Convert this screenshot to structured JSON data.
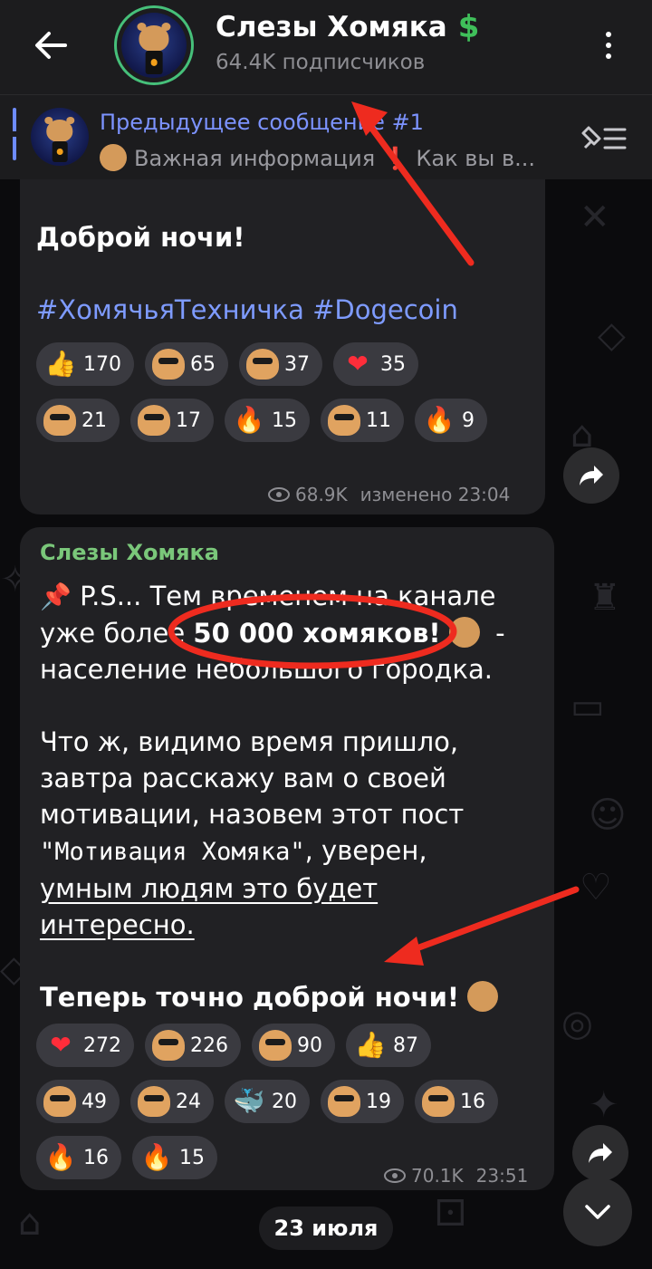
{
  "header": {
    "title": "Слезы Хомяка",
    "subtitle": "64.4K подписчиков",
    "title_badge_icon": "dollar-sign-icon"
  },
  "pinned": {
    "title": "Предыдущее сообщение #1",
    "text_part1": "Важная информация",
    "exclamation": "❗",
    "text_part2": "Как вы в..."
  },
  "message1": {
    "greeting": "Доброй ночи!",
    "hashtag1": "#ХомячьяТехничка",
    "hashtag2": "#Dogecoin",
    "reactions": [
      {
        "icon": "thumbs-up-icon",
        "count": "170"
      },
      {
        "icon": "hamster-laptop-icon",
        "count": "65"
      },
      {
        "icon": "hamster-cool-icon",
        "count": "37"
      },
      {
        "icon": "red-heart-icon",
        "count": "35"
      },
      {
        "icon": "hamster-fire-icon",
        "count": "21"
      },
      {
        "icon": "hamster-money-icon",
        "count": "17"
      },
      {
        "icon": "fire-icon",
        "count": "15"
      },
      {
        "icon": "hamster-face-icon",
        "count": "11"
      },
      {
        "icon": "fire-icon",
        "count": "9"
      }
    ],
    "views": "68.9K",
    "edited_time": "изменено 23:04"
  },
  "message2": {
    "sender": "Слезы Хомяка",
    "line1": "P.S... Тем временем на канале",
    "line2_a": "уже более ",
    "line2_b": "50 000 хомяков!",
    "line2_c": " -",
    "line3": "население небольшого городка.",
    "para2_line1": "Что ж, видимо время пришло,",
    "para2_line2": "завтра расскажу вам о своей",
    "para2_line3": "мотивации, назовем этот пост",
    "para2_line4a": "\"Мотивация Хомяка\"",
    "para2_line4b": ", уверен,",
    "para2_line5": "умным людям это будет",
    "para2_line6": "интересно.",
    "closing": "Теперь точно доброй ночи!",
    "reactions": [
      {
        "icon": "red-heart-icon",
        "count": "272"
      },
      {
        "icon": "hamster-laptop-icon",
        "count": "226"
      },
      {
        "icon": "hamster-cool-icon",
        "count": "90"
      },
      {
        "icon": "thumbs-up-icon",
        "count": "87"
      },
      {
        "icon": "hamster-money-icon",
        "count": "49"
      },
      {
        "icon": "hamster-suit-icon",
        "count": "24"
      },
      {
        "icon": "whale-icon",
        "count": "20"
      },
      {
        "icon": "hamster-face-icon",
        "count": "19"
      },
      {
        "icon": "hamster-fire-icon",
        "count": "16"
      },
      {
        "icon": "fire-icon",
        "count": "16"
      },
      {
        "icon": "fire-icon",
        "count": "15"
      }
    ],
    "views": "70.1K",
    "time": "23:51"
  },
  "date_separator": "23 июля",
  "colors": {
    "accent_green": "#46c07a",
    "link_blue": "#7e9bff",
    "annotation_red": "#ee2b1f",
    "bubble": "#212124"
  }
}
